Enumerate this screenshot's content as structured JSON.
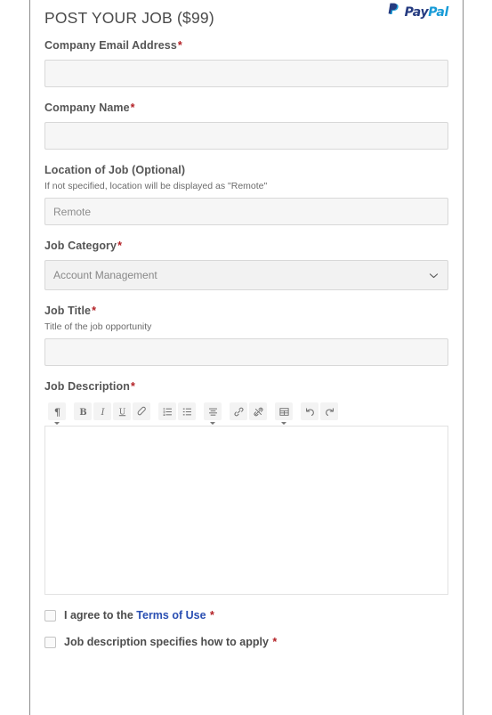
{
  "header": {
    "title": "POST YOUR JOB ($99)",
    "paypal": {
      "mark": "paypal-logo-icon",
      "word_dark": "Pay",
      "word_light": "Pal"
    }
  },
  "form": {
    "fields": [
      {
        "name": "company-email",
        "label": "Company Email Address",
        "required_marker": "*",
        "hint": "",
        "value": "",
        "placeholder": ""
      },
      {
        "name": "company-name",
        "label": "Company Name",
        "required_marker": "*",
        "hint": "",
        "value": "",
        "placeholder": ""
      },
      {
        "name": "job-location",
        "label": "Location of Job (Optional)",
        "required_marker": "",
        "hint": "If not specified, location will be displayed as \"Remote\"",
        "value": "",
        "placeholder": "Remote"
      },
      {
        "name": "job-category",
        "label": "Job Category",
        "required_marker": "*",
        "hint": "",
        "selected": "Account Management",
        "chevron_icon": "chevron-down-icon"
      },
      {
        "name": "job-title",
        "label": "Job Title",
        "required_marker": "*",
        "hint": "Title of the job opportunity",
        "value": "",
        "placeholder": ""
      },
      {
        "name": "job-description",
        "label": "Job Description",
        "required_marker": "*",
        "hint": "",
        "value": ""
      }
    ],
    "editor": {
      "toolbar": [
        {
          "icon": "paragraph-format-icon",
          "label": "Paragraph format",
          "has_caret": true
        },
        {
          "icon": "bold-icon",
          "label": "Bold",
          "has_caret": false
        },
        {
          "icon": "italic-icon",
          "label": "Italic",
          "has_caret": false
        },
        {
          "icon": "underline-icon",
          "label": "Underline",
          "has_caret": false
        },
        {
          "icon": "clear-formatting-icon",
          "label": "Clear formatting",
          "has_caret": false
        },
        {
          "icon": "ordered-list-icon",
          "label": "Ordered list",
          "has_caret": false
        },
        {
          "icon": "unordered-list-icon",
          "label": "Unordered list",
          "has_caret": false
        },
        {
          "icon": "align-icon",
          "label": "Align",
          "has_caret": true
        },
        {
          "icon": "link-icon",
          "label": "Insert link",
          "has_caret": false
        },
        {
          "icon": "unlink-icon",
          "label": "Remove link",
          "has_caret": false
        },
        {
          "icon": "table-icon",
          "label": "Insert table",
          "has_caret": true
        },
        {
          "icon": "undo-icon",
          "label": "Undo",
          "has_caret": false
        },
        {
          "icon": "redo-icon",
          "label": "Redo",
          "has_caret": false
        }
      ],
      "content": "",
      "resize_handle": "editor-resize-handle"
    },
    "checkboxes": [
      {
        "name": "agree-terms",
        "text_before": "I agree to the ",
        "link_text": "Terms of Use",
        "text_after": "",
        "required_marker": "*",
        "checked": false
      },
      {
        "name": "how-to-apply",
        "text_before": "Job description specifies how to apply",
        "link_text": "",
        "text_after": "",
        "required_marker": "*",
        "checked": false
      }
    ]
  },
  "colors": {
    "paypal_dark": "#253b80",
    "paypal_light": "#179bd7",
    "required_red": "#b32025",
    "link_blue": "#2a4fb2",
    "label_gray": "#555555",
    "input_bg": "#f6f6f6",
    "border_gray": "#d8d8d8"
  }
}
